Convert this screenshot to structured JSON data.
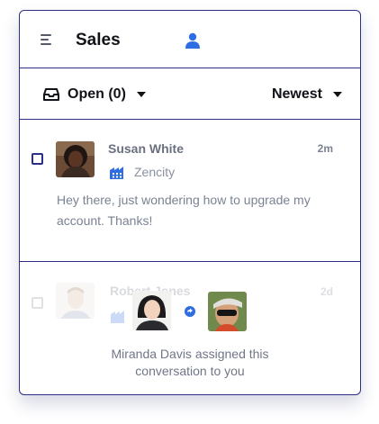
{
  "header": {
    "title": "Sales",
    "menu_icon": "menu-icon",
    "user_icon": "user-icon",
    "accent": "#2f6ee2"
  },
  "filters": {
    "inbox_label": "Open (0)",
    "sort_label": "Newest"
  },
  "conversations": [
    {
      "name": "Susan White",
      "time": "2m",
      "company": "Zencity",
      "preview_lines": [
        "Hey there, just wondering how to upgrade my",
        "account. Thanks!"
      ]
    },
    {
      "name": "Robert Jones",
      "time": "2d"
    }
  ],
  "assignment": {
    "line1": "Miranda Davis assigned this",
    "line2": "conversation to you"
  },
  "colors": {
    "border": "#2d2f86",
    "text_dark": "#111318",
    "muted": "#7a8292"
  }
}
